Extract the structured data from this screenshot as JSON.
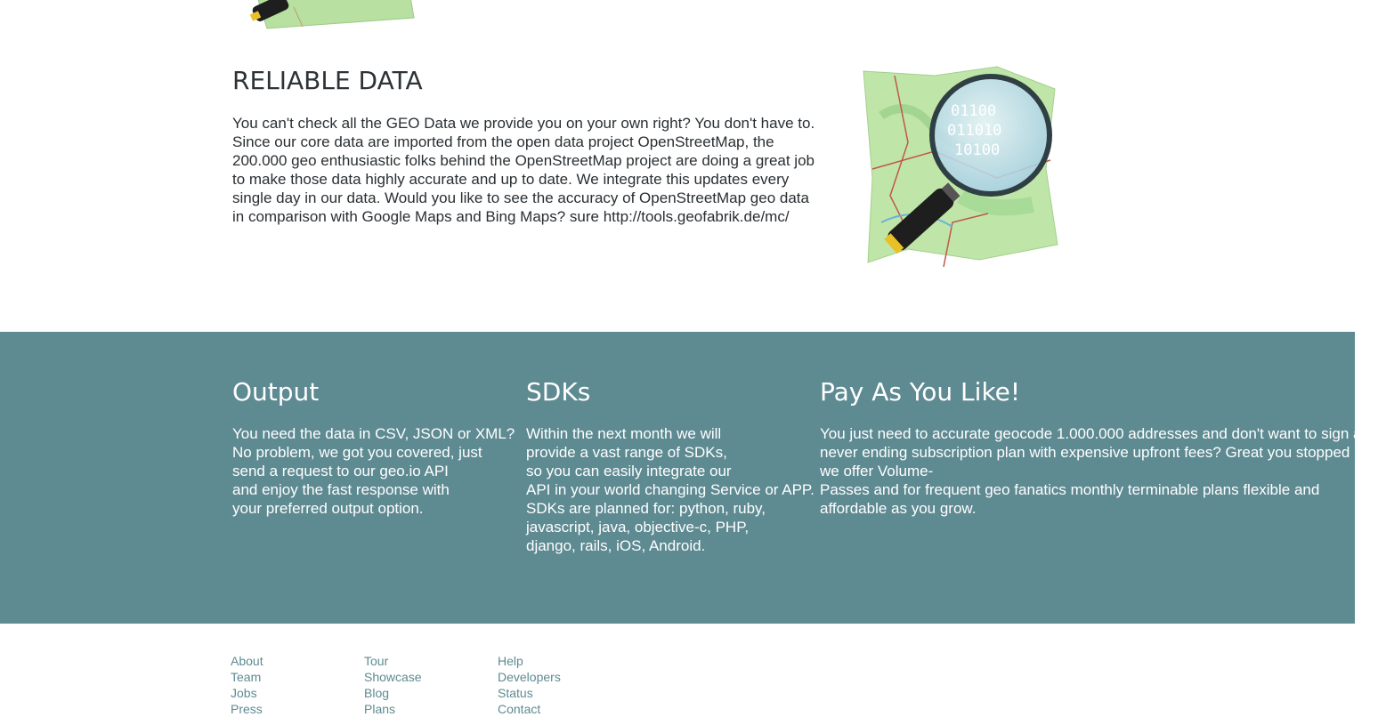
{
  "reliable": {
    "title": "RELIABLE DATA",
    "body": "You can't check all the GEO Data we provide you on your own right? You don't have to. Since our core data are imported from the open data project OpenStreetMap, the 200.000 geo enthusiastic folks behind the OpenStreetMap project are doing a great job to make those data highly accurate and up to date. We integrate this updates every single day in our data. Would you like to see the accuracy of OpenStreetMap geo data in comparison with Google Maps and Bing Maps? sure http://tools.geofabrik.de/mc/",
    "illustration_digits": [
      "01100",
      "011010",
      "10100"
    ]
  },
  "features": {
    "output": {
      "title": "Output",
      "body": "You need the data in CSV, JSON or XML?\nNo problem, we got you covered, just\nsend a request to our geo.io API\nand enjoy the fast response with\nyour preferred output option."
    },
    "sdks": {
      "title": "SDKs",
      "body": "Within the next month we will\nprovide a vast range of SDKs,\nso you can easily integrate our\nAPI in your world changing Service or APP.\nSDKs are planned for: python, ruby,\njavascript, java, objective-c, PHP,\ndjango, rails, iOS, Android."
    },
    "pay": {
      "title": "Pay As You Like!",
      "body": "You just need to accurate geocode 1.000.000 addresses and don't want to sign a never ending subscription plan with expensive upfront fees? Great you stopped here we offer Volume-\nPasses and for frequent geo fanatics monthly terminable plans  flexible and affordable as you grow."
    }
  },
  "footer": {
    "col1": [
      "About",
      "Team",
      "Jobs",
      "Press"
    ],
    "col2": [
      "Tour",
      "Showcase",
      "Blog",
      "Plans"
    ],
    "col3": [
      "Help",
      "Developers",
      "Status",
      "Contact"
    ]
  },
  "colors": {
    "band": "#5e8a92",
    "footer_link": "#5e8a92",
    "map_green": "#b8e0a0",
    "magnifier_handle": "#1e1e1e"
  }
}
